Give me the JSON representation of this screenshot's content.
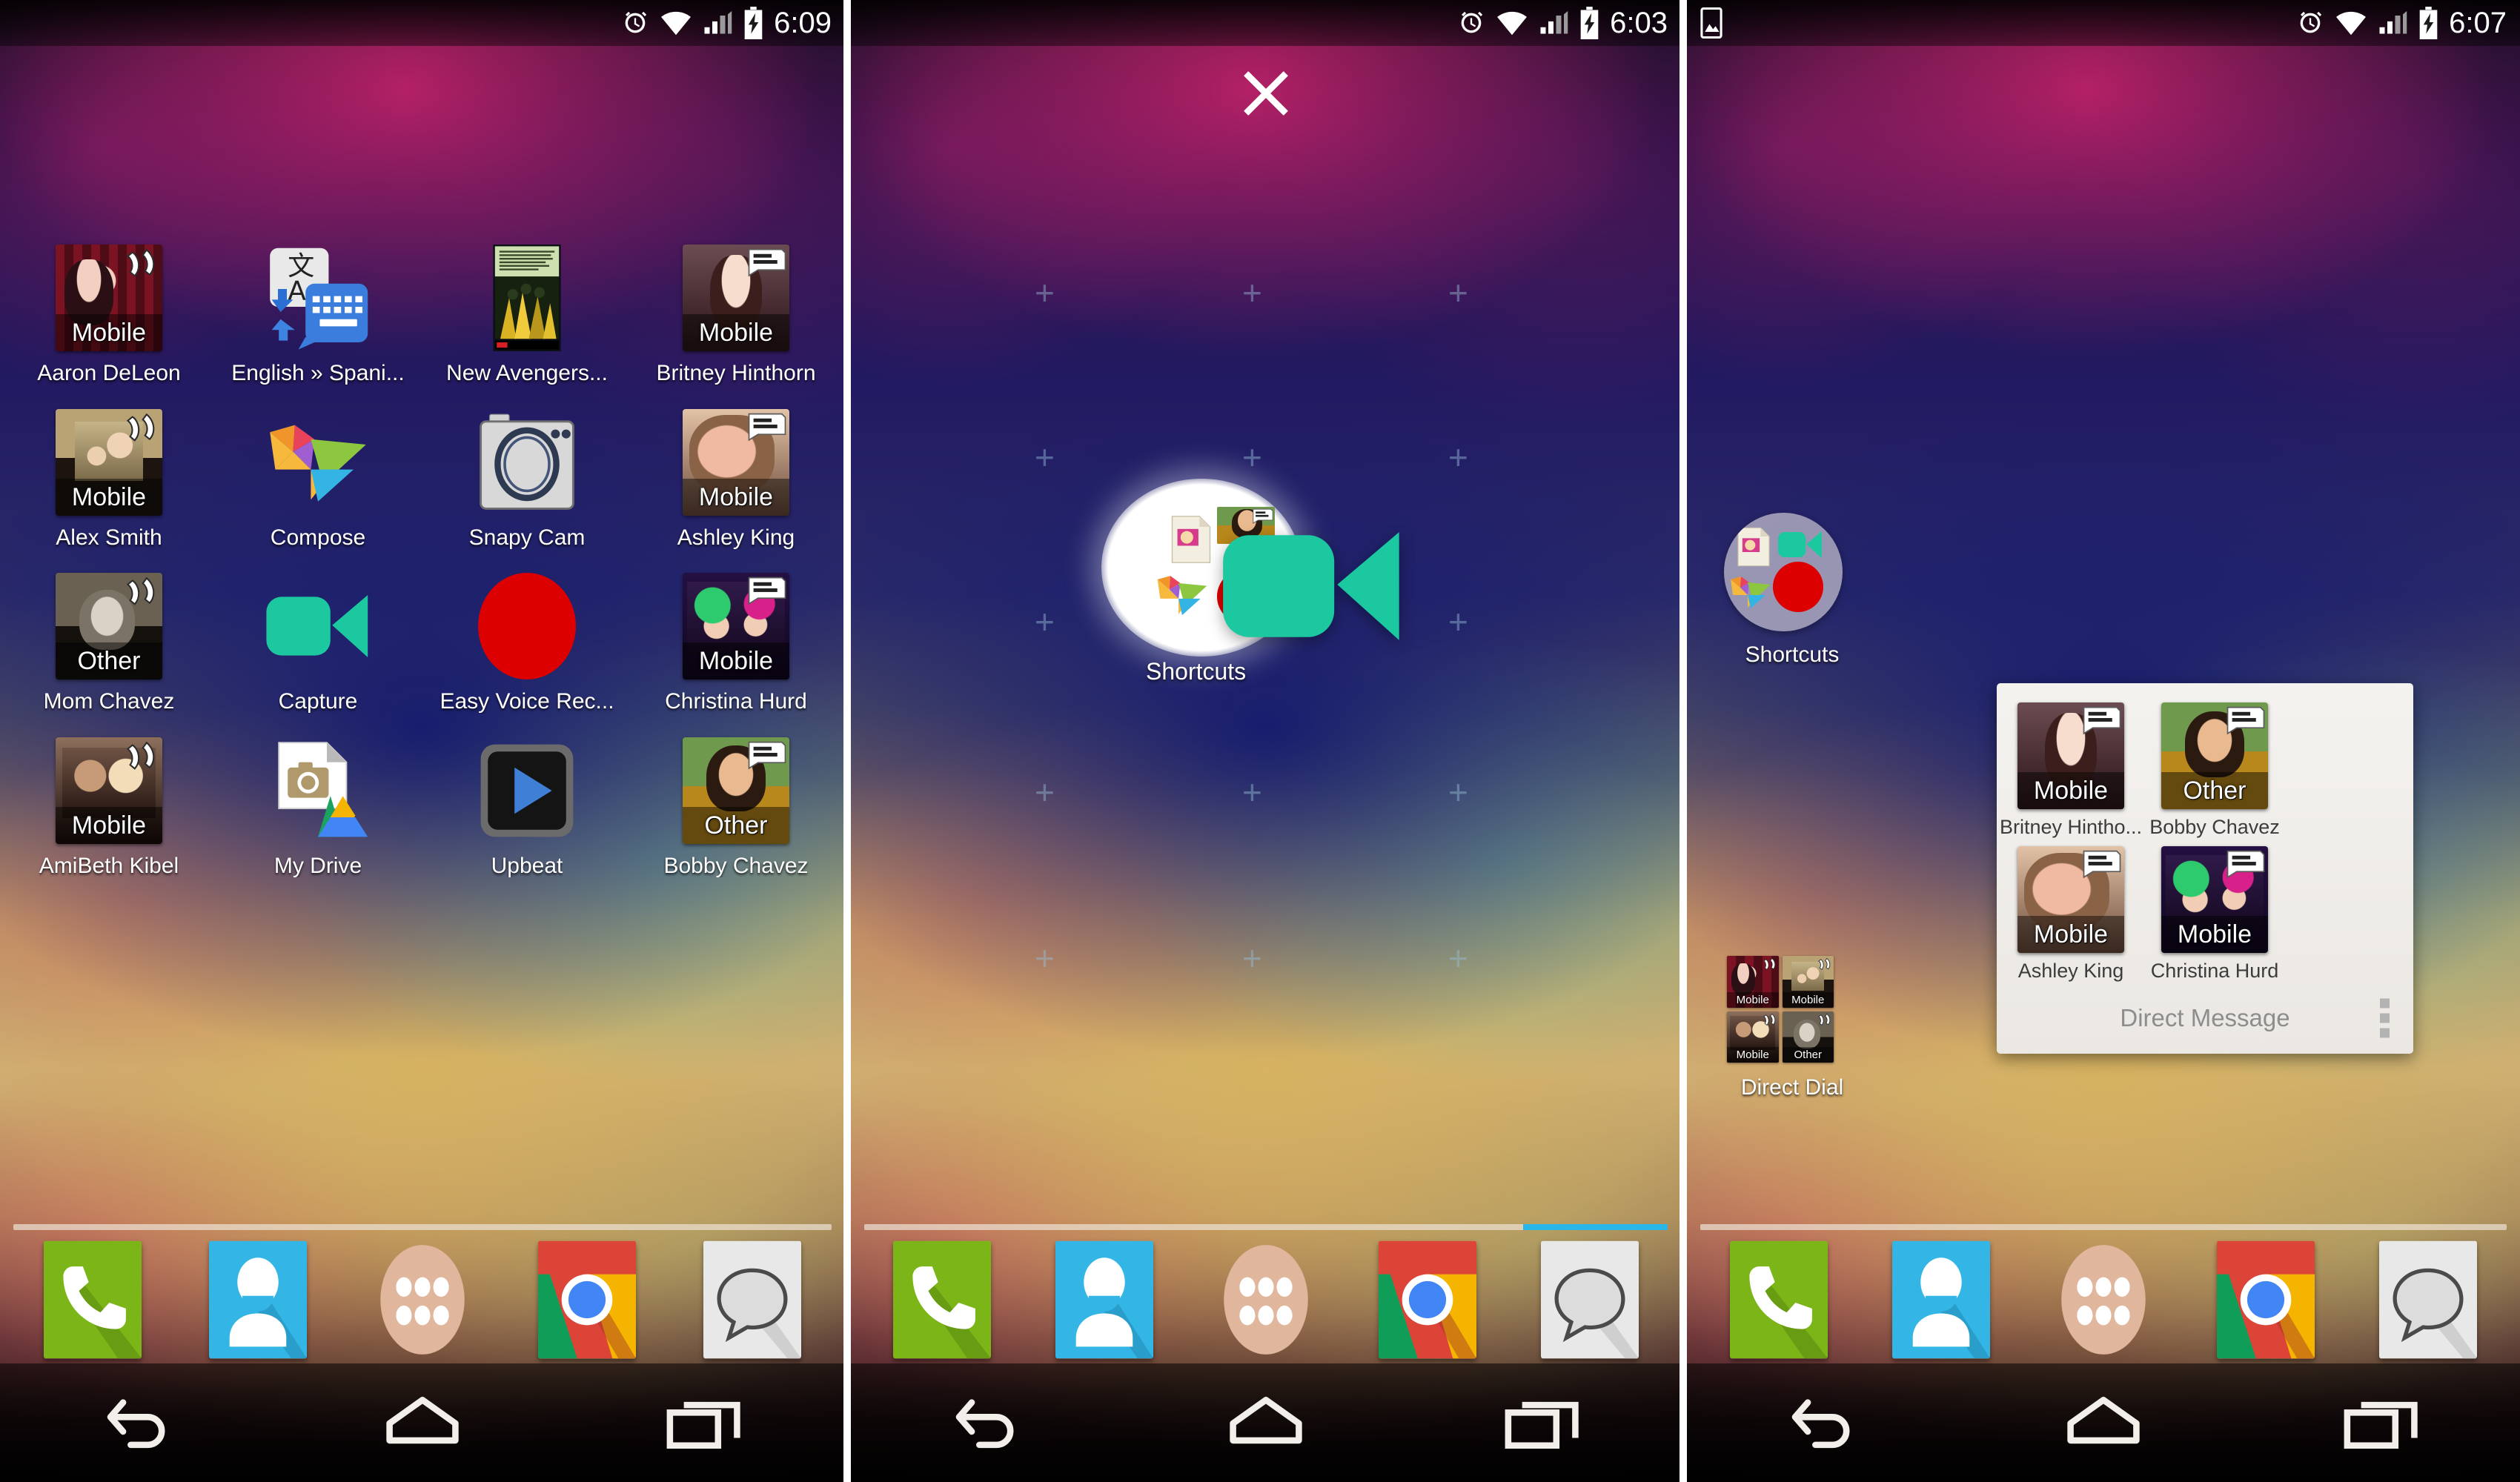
{
  "panels": [
    {
      "id": "home-screen",
      "status": {
        "clock": "6:09",
        "icons": [
          "alarm-icon",
          "wifi-icon",
          "signal-icon",
          "battery-charging-icon"
        ],
        "left_icons": []
      },
      "apps": [
        {
          "label": "Aaron DeLeon",
          "type": "contact",
          "sub": "Mobile",
          "badge": "phone-icon",
          "photo": "ph-aaron"
        },
        {
          "label": "English » Spani...",
          "type": "app",
          "icon": "translate-keyboard-icon"
        },
        {
          "label": "New Avengers...",
          "type": "app",
          "icon": "comic-cover-icon"
        },
        {
          "label": "Britney Hinthorn",
          "type": "contact",
          "sub": "Mobile",
          "badge": "message-icon",
          "photo": "ph-britney"
        },
        {
          "label": "Alex Smith",
          "type": "contact",
          "sub": "Mobile",
          "badge": "phone-icon",
          "photo": "ph-alex"
        },
        {
          "label": "Compose",
          "type": "app",
          "icon": "origami-compose-icon"
        },
        {
          "label": "Snapy Cam",
          "type": "app",
          "icon": "camera-body-icon"
        },
        {
          "label": "Ashley King",
          "type": "contact",
          "sub": "Mobile",
          "badge": "message-icon",
          "photo": "ph-ashley"
        },
        {
          "label": "Mom Chavez",
          "type": "contact",
          "sub": "Other",
          "badge": "phone-icon",
          "photo": "ph-mom"
        },
        {
          "label": "Capture",
          "type": "app",
          "icon": "camcorder-icon"
        },
        {
          "label": "Easy Voice Rec...",
          "type": "app",
          "icon": "record-circle-icon"
        },
        {
          "label": "Christina Hurd",
          "type": "contact",
          "sub": "Mobile",
          "badge": "message-icon",
          "photo": "ph-christina"
        },
        {
          "label": "AmiBeth Kibel",
          "type": "contact",
          "sub": "Mobile",
          "badge": "phone-icon",
          "photo": "ph-ami"
        },
        {
          "label": "My Drive",
          "type": "app",
          "icon": "drive-camera-icon"
        },
        {
          "label": "Upbeat",
          "type": "app",
          "icon": "play-button-icon"
        },
        {
          "label": "Bobby Chavez",
          "type": "contact",
          "sub": "Other",
          "badge": "message-icon",
          "photo": "ph-bobby"
        }
      ],
      "page_indicator": {
        "fill_percent": 0,
        "accent": "#29b6e8"
      }
    },
    {
      "id": "drag-drop-screen",
      "status": {
        "clock": "6:03",
        "icons": [
          "alarm-icon",
          "wifi-icon",
          "signal-icon",
          "battery-charging-icon"
        ],
        "left_icons": []
      },
      "close_label": "close-icon",
      "drag": {
        "folder_label": "Shortcuts",
        "dragged_item": "camcorder-icon"
      },
      "page_indicator": {
        "fill_percent": 82,
        "accent": "#29b6e8"
      }
    },
    {
      "id": "folder-popup-screen",
      "status": {
        "clock": "6:07",
        "icons": [
          "alarm-icon",
          "wifi-icon",
          "signal-icon",
          "battery-charging-icon"
        ],
        "left_icons": [
          "screenshot-icon"
        ]
      },
      "folders": [
        {
          "label": "Shortcuts",
          "kind": "circle",
          "items": [
            "document-icon",
            "camcorder-icon",
            "origami-compose-icon",
            "record-circle-icon"
          ]
        },
        {
          "label": "Direct Dial",
          "kind": "quad",
          "items": [
            {
              "sub": "Mobile",
              "badge": "phone-icon",
              "photo": "ph-aaron"
            },
            {
              "sub": "Mobile",
              "badge": "phone-icon",
              "photo": "ph-alex"
            },
            {
              "sub": "Mobile",
              "badge": "phone-icon",
              "photo": "ph-ami"
            },
            {
              "sub": "Other",
              "badge": "phone-icon",
              "photo": "ph-mom"
            }
          ]
        }
      ],
      "popup": {
        "title": "Direct Message",
        "overflow": "kebab-menu-icon",
        "contacts": [
          {
            "label": "Britney Hintho...",
            "sub": "Mobile",
            "badge": "message-icon",
            "photo": "ph-britney"
          },
          {
            "label": "Bobby Chavez",
            "sub": "Other",
            "badge": "message-icon",
            "photo": "ph-bobby"
          },
          {
            "label": "Ashley King",
            "sub": "Mobile",
            "badge": "message-icon",
            "photo": "ph-ashley"
          },
          {
            "label": "Christina Hurd",
            "sub": "Mobile",
            "badge": "message-icon",
            "photo": "ph-christina"
          }
        ]
      },
      "page_indicator": {
        "fill_percent": 0,
        "accent": "#29b6e8"
      }
    }
  ],
  "dock": [
    {
      "name": "phone",
      "color": "#7cb518"
    },
    {
      "name": "contacts",
      "color": "#33b5e5"
    },
    {
      "name": "app-drawer",
      "color": "#e0b79c"
    },
    {
      "name": "chrome",
      "color": "#db4437"
    },
    {
      "name": "messaging",
      "color": "#e8e8e8"
    }
  ],
  "navbar": [
    {
      "name": "back-icon"
    },
    {
      "name": "home-icon"
    },
    {
      "name": "recents-icon"
    }
  ],
  "colors": {
    "accent": "#29b6e8",
    "teal": "#1bc8a0",
    "record_red": "#dd0000",
    "status_text": "#ffffff",
    "popup_bg": "#f1efec",
    "popup_text": "#3c3c3c",
    "popup_muted": "#8d8d8d"
  }
}
